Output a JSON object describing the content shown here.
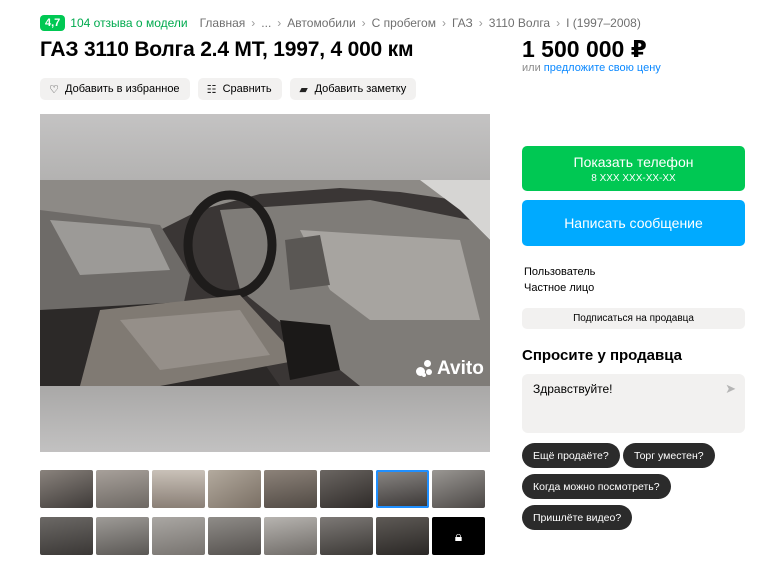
{
  "breadcrumbs": {
    "rating": "4,7",
    "reviews": "104 отзыва о модели",
    "items": [
      "Главная",
      "...",
      "Автомобили",
      "С пробегом",
      "ГАЗ",
      "3110 Волга",
      "I (1997–2008)"
    ],
    "separator": "›"
  },
  "listing": {
    "title": "ГАЗ 3110 Волга 2.4 MT, 1997, 4 000 км",
    "price": "1 500 000 ₽",
    "offer_prefix": "или",
    "offer_link": "предложите свою цену"
  },
  "actions": [
    {
      "label": "Добавить в избранное",
      "icon": "heart-icon"
    },
    {
      "label": "Сравнить",
      "icon": "compare-icon"
    },
    {
      "label": "Добавить заметку",
      "icon": "note-icon"
    }
  ],
  "gallery": {
    "watermark": "Avito",
    "thumbnails_row1": 8,
    "thumbnails_row2": 8,
    "selected_index": 6,
    "locked_icon": "lock-icon"
  },
  "contact": {
    "phone_label": "Показать телефон",
    "phone_mask": "8 XXX XXX-XX-XX",
    "message_label": "Написать сообщение",
    "seller_name": "Пользователь",
    "seller_type": "Частное лицо",
    "subscribe_label": "Подписаться на продавца"
  },
  "ask": {
    "title": "Спросите у продавца",
    "message": "Здравствуйте!",
    "send_icon": "send-icon",
    "chips": [
      "Ещё продаёте?",
      "Торг уместен?",
      "Когда можно посмотреть?",
      "Пришлёте видео?"
    ]
  },
  "colors": {
    "green": "#00c853",
    "blue": "#00aaff",
    "link": "#0a88ff",
    "chip": "#2b2b2b"
  }
}
